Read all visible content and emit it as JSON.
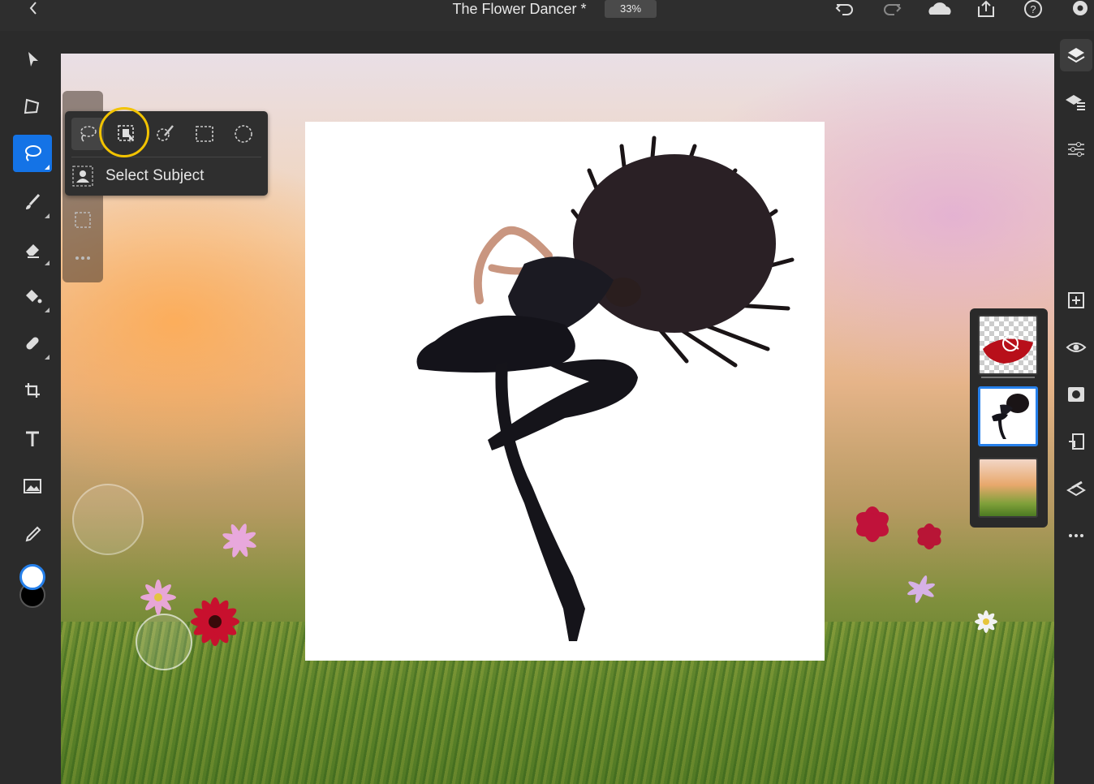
{
  "document": {
    "title": "The Flower Dancer *",
    "zoom": "33%"
  },
  "lasso_popup": {
    "options": [
      "lasso",
      "select-subject",
      "quick-select",
      "rectangle-marquee",
      "ellipse-marquee"
    ],
    "menu_item": "Select Subject"
  },
  "colors": {
    "accent": "#1473e6",
    "highlight": "#f2c300",
    "foreground": "#ffffff",
    "background": "#000000"
  },
  "layers": [
    "red-brush-layer",
    "dancer-layer",
    "background-field-layer"
  ]
}
